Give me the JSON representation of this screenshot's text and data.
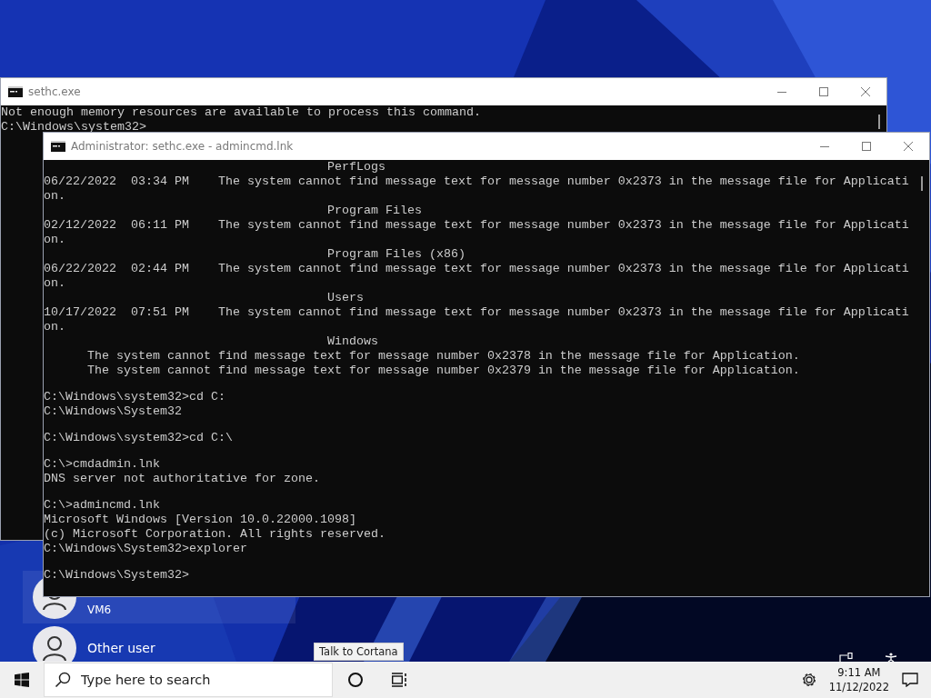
{
  "login": {
    "users": [
      {
        "name": "VM6"
      },
      {
        "name": "Other user"
      }
    ]
  },
  "windows": [
    {
      "title": "sethc.exe",
      "blocks": [
        [
          "Not enough memory resources are available to process this command.",
          "C:\\Windows\\system32>"
        ]
      ]
    },
    {
      "title": "Administrator: sethc.exe - admincmd.lnk",
      "blocks": [
        [
          "                                       PerfLogs",
          "06/22/2022  03:34 PM    The system cannot find message text for message number 0x2373 in the message file for Applicati",
          "on.",
          "                                       Program Files",
          "02/12/2022  06:11 PM    The system cannot find message text for message number 0x2373 in the message file for Applicati",
          "on.",
          "                                       Program Files (x86)",
          "06/22/2022  02:44 PM    The system cannot find message text for message number 0x2373 in the message file for Applicati",
          "on.",
          "                                       Users",
          "10/17/2022  07:51 PM    The system cannot find message text for message number 0x2373 in the message file for Applicati",
          "on.",
          "                                       Windows",
          "      The system cannot find message text for message number 0x2378 in the message file for Application.",
          "      The system cannot find message text for message number 0x2379 in the message file for Application."
        ],
        [
          "C:\\Windows\\system32>cd C:",
          "C:\\Windows\\System32"
        ],
        [
          "C:\\Windows\\system32>cd C:\\"
        ],
        [
          "C:\\>cmdadmin.lnk",
          "DNS server not authoritative for zone."
        ],
        [
          "C:\\>admincmd.lnk",
          "Microsoft Windows [Version 10.0.22000.1098]",
          "(c) Microsoft Corporation. All rights reserved.",
          "C:\\Windows\\System32>explorer"
        ],
        [
          "C:\\Windows\\System32>"
        ]
      ]
    }
  ],
  "tooltip": "Talk to Cortana",
  "taskbar": {
    "search": {
      "placeholder": "Type here to search"
    },
    "time": "9:11 AM",
    "date": "11/12/2022"
  }
}
